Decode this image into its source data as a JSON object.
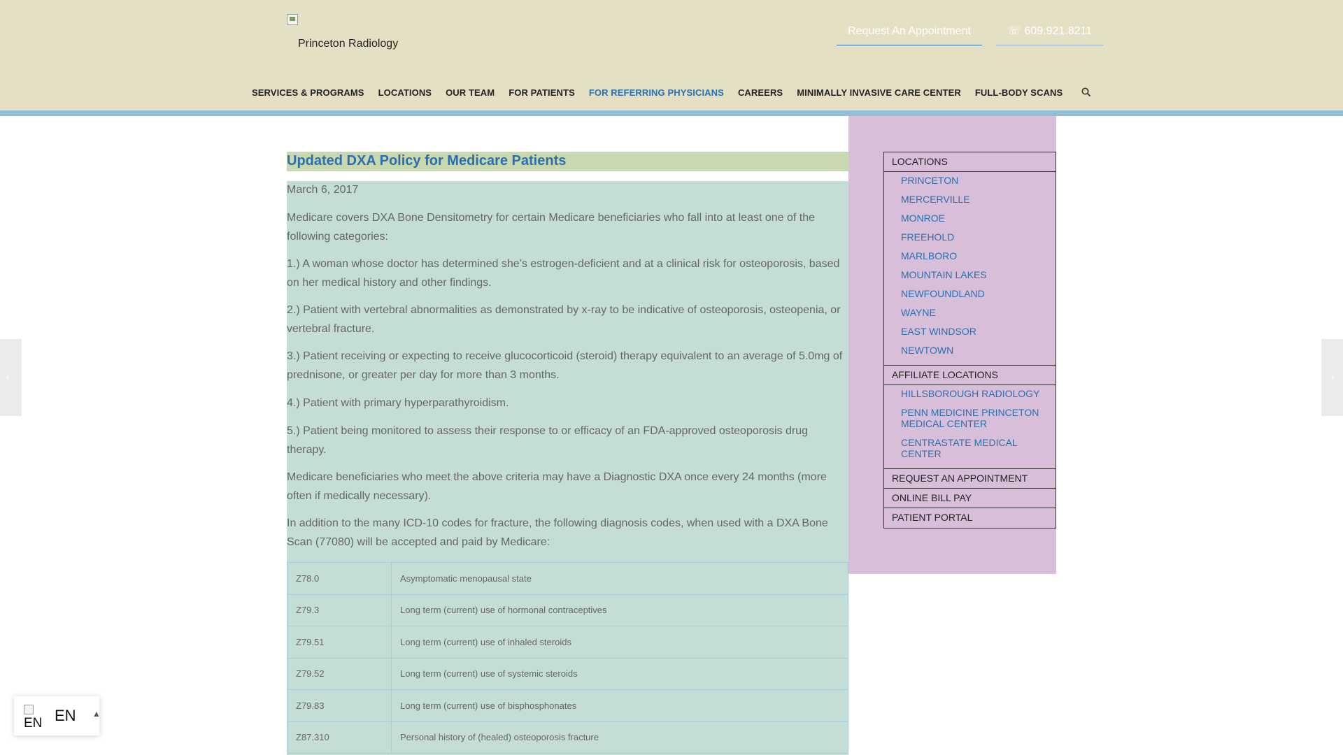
{
  "header": {
    "logo_alt": "Princeton Radiology",
    "appointment_button": "Request An Appointment",
    "phone_button": " 609.921.8211",
    "phone_glyph": "",
    "phone_number": "609.921.8211"
  },
  "nav": {
    "items": [
      {
        "label": "SERVICES & PROGRAMS"
      },
      {
        "label": "LOCATIONS"
      },
      {
        "label": "OUR TEAM"
      },
      {
        "label": "FOR PATIENTS"
      },
      {
        "label": "FOR REFERRING PHYSICIANS",
        "active": true
      },
      {
        "label": "CAREERS"
      },
      {
        "label": "MINIMALLY INVASIVE CARE CENTER"
      },
      {
        "label": "FULL-BODY SCANS"
      }
    ]
  },
  "post": {
    "title": "Updated DXA Policy for Medicare Patients",
    "date": "March 6, 2017",
    "paragraphs": [
      "Medicare covers DXA Bone Densitometry for certain Medicare beneficiaries who fall into at least one of the following categories:",
      "1.) A woman whose doctor has determined she’s estrogen-deficient and at a clinical risk for osteoporosis, based on her medical history and other findings.",
      "2.) Patient with vertebral abnormalities as demonstrated by x-ray to be indicative of osteoporosis, osteopenia, or vertebral fracture.",
      "3.) Patient receiving or expecting to receive glucocorticoid (steroid) therapy equivalent to an average of 5.0mg of prednisone, or greater per day for more than 3 months.",
      "4.) Patient with primary hyperparathyroidism.",
      "5.) Patient being monitored to assess their response to or efficacy of an FDA-approved osteoporosis drug therapy.",
      "Medicare beneficiaries who meet the above criteria may have a Diagnostic DXA once every 24 months (more often if medically necessary).",
      "In addition to the many ICD-10 codes for fracture, the following diagnosis codes, when used with a DXA Bone Scan (77080) will be accepted and paid by Medicare:"
    ],
    "codes": [
      {
        "code": "Z78.0",
        "desc": "Asymptomatic menopausal state"
      },
      {
        "code": "Z79.3",
        "desc": "Long term (current) use of hormonal contraceptives"
      },
      {
        "code": "Z79.51",
        "desc": "Long term (current) use of inhaled steroids"
      },
      {
        "code": "Z79.52",
        "desc": "Long term (current) use of systemic steroids"
      },
      {
        "code": "Z79.83",
        "desc": "Long term (current) use of bisphosphonates"
      },
      {
        "code": "Z87.310",
        "desc": "Personal history of (healed) osteoporosis fracture"
      }
    ]
  },
  "sidebar": {
    "locations_heading": "LOCATIONS",
    "locations": [
      "PRINCETON",
      "MERCERVILLE",
      "MONROE",
      "FREEHOLD",
      "MARLBORO",
      "MOUNTAIN LAKES",
      "NEWFOUNDLAND",
      "WAYNE",
      "EAST WINDSOR",
      "NEWTOWN"
    ],
    "affiliate_heading": "AFFILIATE LOCATIONS",
    "affiliates": [
      "HILLSBOROUGH RADIOLOGY",
      "PENN MEDICINE PRINCETON MEDICAL CENTER",
      "CENTRASTATE MEDICAL CENTER"
    ],
    "request_appointment": "REQUEST AN APPOINTMENT",
    "online_bill_pay": "ONLINE BILL PAY",
    "patient_portal": "PATIENT PORTAL"
  },
  "language": {
    "flag_alt": "EN",
    "code": "EN"
  },
  "colors": {
    "header_bg": "#e5e0c4",
    "accent_blue": "#2a6fb0",
    "content_bg": "#c4ddd6",
    "sidebar_bg": "#d8bed8",
    "title_bar": "#c9d8ae"
  },
  "icons": [
    "search-icon",
    "phone-icon",
    "chevron-left-icon",
    "chevron-right-icon",
    "chevron-up-icon",
    "broken-image-icon"
  ]
}
